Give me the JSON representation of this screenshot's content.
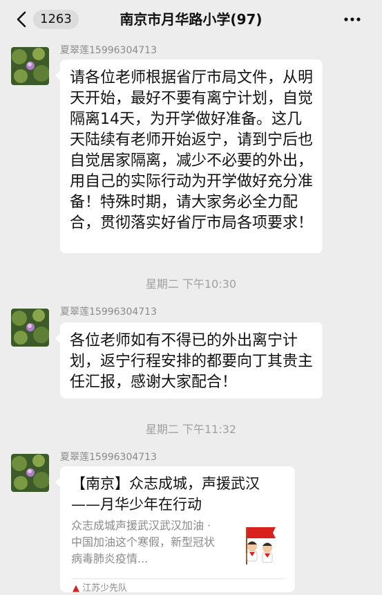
{
  "header": {
    "back_icon": "chevron-left-icon",
    "unread_count": "1263",
    "title": "南京市月华路小学(97)",
    "more_icon": "ellipsis-icon"
  },
  "messages": [
    {
      "sender": "夏翠莲15996304713",
      "text": "请各位老师根据省厅市局文件，从明天开始，最好不要有离宁计划，自觉隔离14天，为开学做好准备。这几天陆续有老师开始返宁，请到宁后也自觉居家隔离，减少不必要的外出，用自己的实际行动为开学做好充分准备！特殊时期，请大家务必全力配合，贯彻落实好省厅市局各项要求！"
    },
    {
      "timestamp": "星期二 下午10:30",
      "sender": "夏翠莲15996304713",
      "text": "各位老师如有不得已的外出离宁计划，返宁行程安排的都要向丁其贵主任汇报，感谢大家配合！"
    },
    {
      "timestamp": "星期二 下午11:32",
      "sender": "夏翠莲15996304713",
      "card": {
        "title": "【南京】众志成城，声援武汉——月华少年在行动",
        "description": "众志成城声援武汉武汉加油 · 中国加油这个寒假，新型冠状病毒肺炎疫情...",
        "source": "江苏少先队"
      }
    }
  ],
  "colors": {
    "background": "#ededed",
    "bubble": "#ffffff",
    "secondary_text": "#8a8a8a"
  }
}
